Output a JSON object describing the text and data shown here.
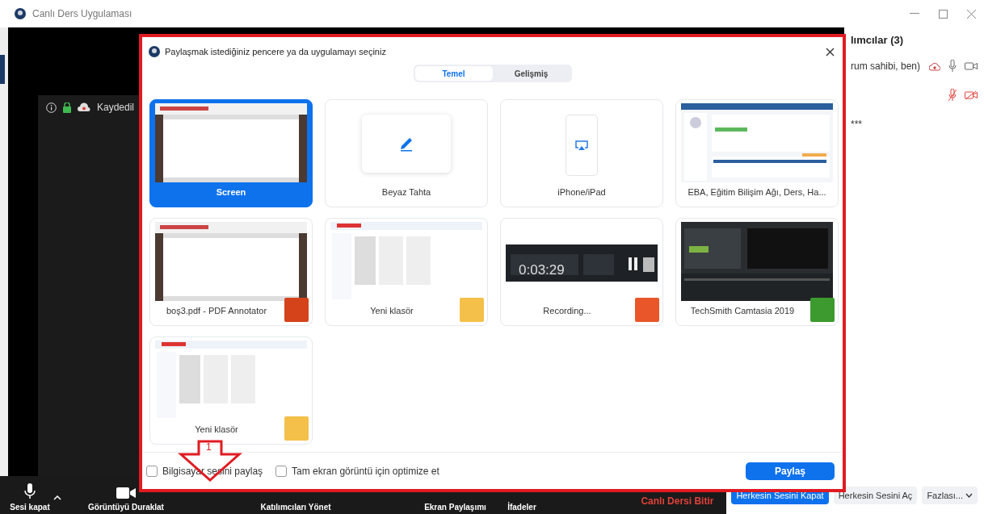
{
  "window": {
    "title": "Canlı Ders Uygulaması"
  },
  "meeting_bar": {
    "recording_label": "Kaydedil"
  },
  "participants_panel": {
    "title": "lımcılar (3)",
    "rows": [
      {
        "name": "rum sahibi, ben)",
        "recording": true,
        "muted": false,
        "video_off": false
      },
      {
        "muted": true,
        "video_off": true
      },
      {
        "name": "***"
      }
    ]
  },
  "toolbar": {
    "items": [
      {
        "kind": "mic",
        "label": "Sesi kapat"
      },
      {
        "kind": "video",
        "label": "Görüntüyü Duraklat"
      },
      {
        "kind": "participants",
        "label": "Katılımcıları Yönet"
      },
      {
        "kind": "share",
        "label": "Ekran Paylaşımı"
      },
      {
        "kind": "reactions",
        "label": "İfadeler"
      }
    ],
    "end_label": "Canlı Dersi Bitir"
  },
  "panel_buttons": [
    {
      "label": "Herkesin Sesini Kapat",
      "primary": true
    },
    {
      "label": "Herkesin Sesini Aç",
      "primary": false
    },
    {
      "label": "Fazlası...",
      "primary": false,
      "dropdown": true
    }
  ],
  "dialog": {
    "title": "Paylaşmak istediğiniz pencere ya da uygulamayı seçiniz",
    "tabs": [
      {
        "label": "Temel",
        "selected": true
      },
      {
        "label": "Gelişmiş",
        "selected": false
      }
    ],
    "sources": [
      {
        "kind": "screen",
        "label": "Screen",
        "selected": true
      },
      {
        "kind": "whiteboard",
        "label": "Beyaz Tahta",
        "selected": false
      },
      {
        "kind": "device",
        "label": "iPhone/iPad",
        "selected": false
      },
      {
        "kind": "window",
        "label": "EBA, Eğitim Bilişim Ağı, Ders, Ha...",
        "selected": false
      },
      {
        "kind": "window",
        "label": "boş3.pdf - PDF Annotator",
        "selected": false,
        "color": "#d5431b"
      },
      {
        "kind": "window",
        "label": "Yeni klasör",
        "selected": false,
        "color": "#f4c04a"
      },
      {
        "kind": "window",
        "label": "Recording...",
        "selected": false,
        "thumb_text": "0:03:29",
        "color": "#e8562a"
      },
      {
        "kind": "window",
        "label": "TechSmith Camtasia 2019",
        "selected": false,
        "color": "#3c9a2e"
      },
      {
        "kind": "window",
        "label": "Yeni klasör",
        "selected": false,
        "color": "#f4c04a"
      }
    ],
    "options": [
      {
        "label": "Bilgisayar sesini paylaş",
        "checked": false
      },
      {
        "label": "Tam ekran görüntü için optimize et",
        "checked": false
      }
    ],
    "share_button": "Paylaş",
    "annotation": {
      "number": "1"
    }
  }
}
